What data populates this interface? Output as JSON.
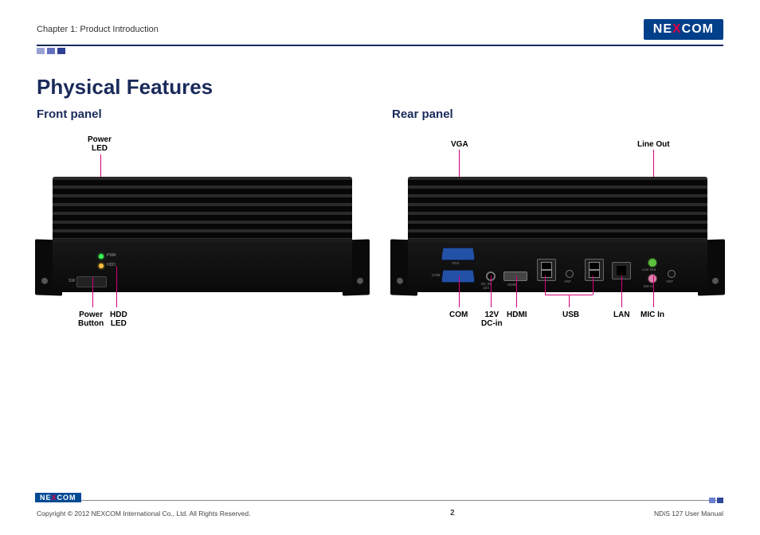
{
  "header": {
    "chapter": "Chapter 1: Product Introduction",
    "logo_ne": "NE",
    "logo_x": "X",
    "logo_com": "COM"
  },
  "title": "Physical Features",
  "front": {
    "title": "Front panel",
    "labels": {
      "power_led": "Power\nLED",
      "power_button": "Power\nButton",
      "hdd_led": "HDD\nLED"
    },
    "silk": {
      "pwr": "PWR",
      "hdd": "HDD",
      "sw": "SW"
    }
  },
  "rear": {
    "title": "Rear panel",
    "labels": {
      "vga": "VGA",
      "line_out": "Line Out",
      "com": "COM",
      "dcin": "12V\nDC-in",
      "hdmi": "HDMI",
      "usb": "USB",
      "lan": "LAN",
      "mic": "MIC In"
    },
    "silk": {
      "vga": "VGA",
      "com": "COM",
      "dcin": "DC IN\n12V",
      "hdmi": "HDMI",
      "ant": "ANT",
      "lineout": "Line Out",
      "micin": "Mic In"
    }
  },
  "footer": {
    "copyright": "Copyright © 2012 NEXCOM International Co., Ltd. All Rights Reserved.",
    "page": "2",
    "doc": "NDiS 127 User Manual",
    "logo_ne": "NE",
    "logo_x": "X",
    "logo_com": "COM"
  }
}
